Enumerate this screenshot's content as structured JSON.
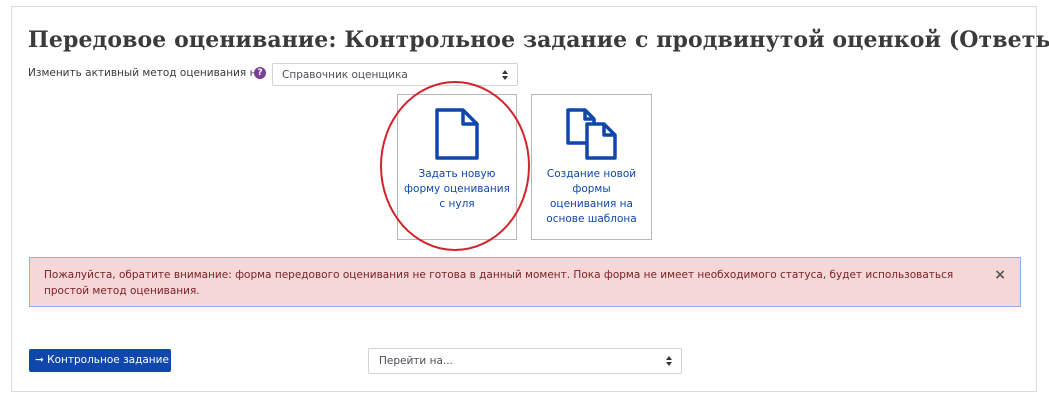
{
  "page": {
    "title": "Передовое оценивание: Контрольное задание с продвинутой оценкой (Ответы)"
  },
  "method": {
    "label": "Изменить активный метод оценивания на",
    "help_icon": "question-circle-icon",
    "selected": "Справочник оценщика"
  },
  "tiles": [
    {
      "label": "Задать новую форму оценивания с нуля",
      "icon": "document-icon"
    },
    {
      "label": "Создание новой формы оценивания на основе шаблона",
      "icon": "documents-copy-icon"
    }
  ],
  "alert": {
    "text": "Пожалуйста, обратите внимание: форма передового оценивания не готова в данный момент. Пока форма не имеет необходимого статуса, будет использоваться простой метод оценивания.",
    "close": "×"
  },
  "footer": {
    "back_button": "➞ Контрольное задание",
    "jump_placeholder": "Перейти на..."
  },
  "colors": {
    "accent": "#0f47ad",
    "alert_bg": "#f5d7d8",
    "alert_text": "#7c2125",
    "highlight": "#d2232a",
    "help_icon": "#7b3f98"
  }
}
